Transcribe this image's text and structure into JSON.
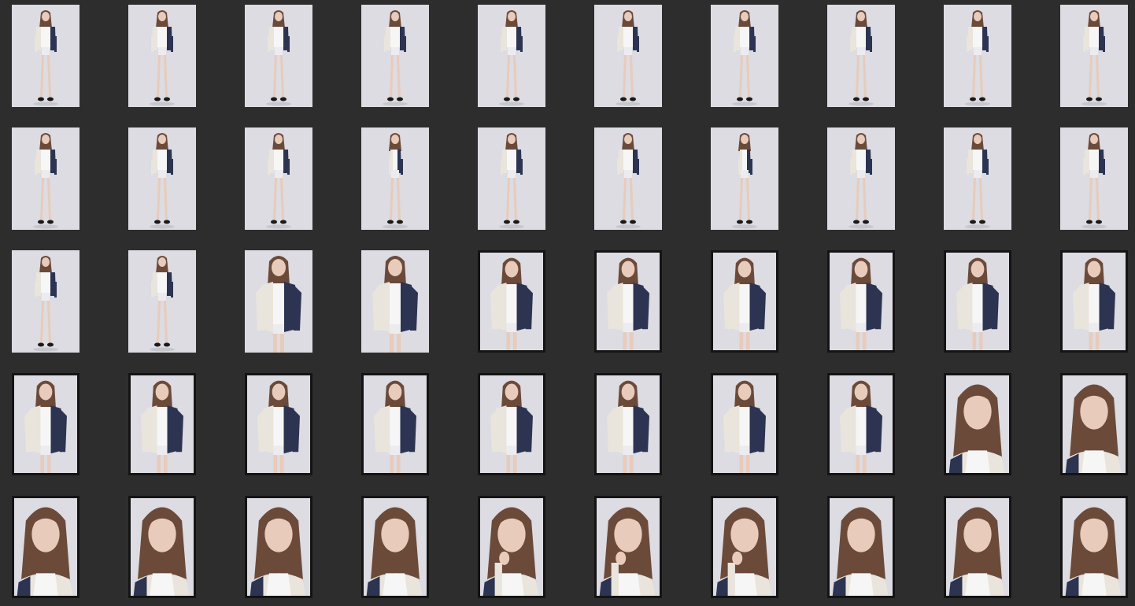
{
  "gallery": {
    "rows": [
      {
        "style": "plain",
        "shots": [
          "full",
          "full",
          "full",
          "full",
          "full",
          "full",
          "full",
          "full",
          "full",
          "full"
        ]
      },
      {
        "style": "plain",
        "shots": [
          "full",
          "full",
          "full",
          "full-side",
          "full",
          "full",
          "full-side",
          "full",
          "full",
          "full"
        ]
      },
      {
        "style": "plain",
        "shots": [
          "full",
          "full",
          "three-quarter",
          "three-quarter",
          "three-quarter",
          "three-quarter",
          "three-quarter",
          "three-quarter",
          "three-quarter",
          "three-quarter"
        ],
        "framed_from": 4
      },
      {
        "style": "framed",
        "shots": [
          "three-quarter",
          "three-quarter",
          "three-quarter",
          "three-quarter",
          "three-quarter",
          "three-quarter",
          "three-quarter",
          "three-quarter",
          "portrait",
          "portrait"
        ]
      },
      {
        "style": "framed",
        "shots": [
          "portrait",
          "portrait",
          "portrait",
          "portrait",
          "portrait-hand",
          "portrait-hand",
          "portrait-hand",
          "portrait",
          "portrait",
          "portrait"
        ]
      }
    ],
    "colors": {
      "background": "#2d2d2d",
      "backdrop": "#dcdce2",
      "frame": "#141414",
      "hair": "#6b4a3a",
      "skin": "#e8cbbb",
      "jacket_navy": "#2c3452",
      "jacket_cream": "#e9e5dc",
      "shirt": "#f6f6f6",
      "shoe": "#1a1a1a"
    }
  }
}
